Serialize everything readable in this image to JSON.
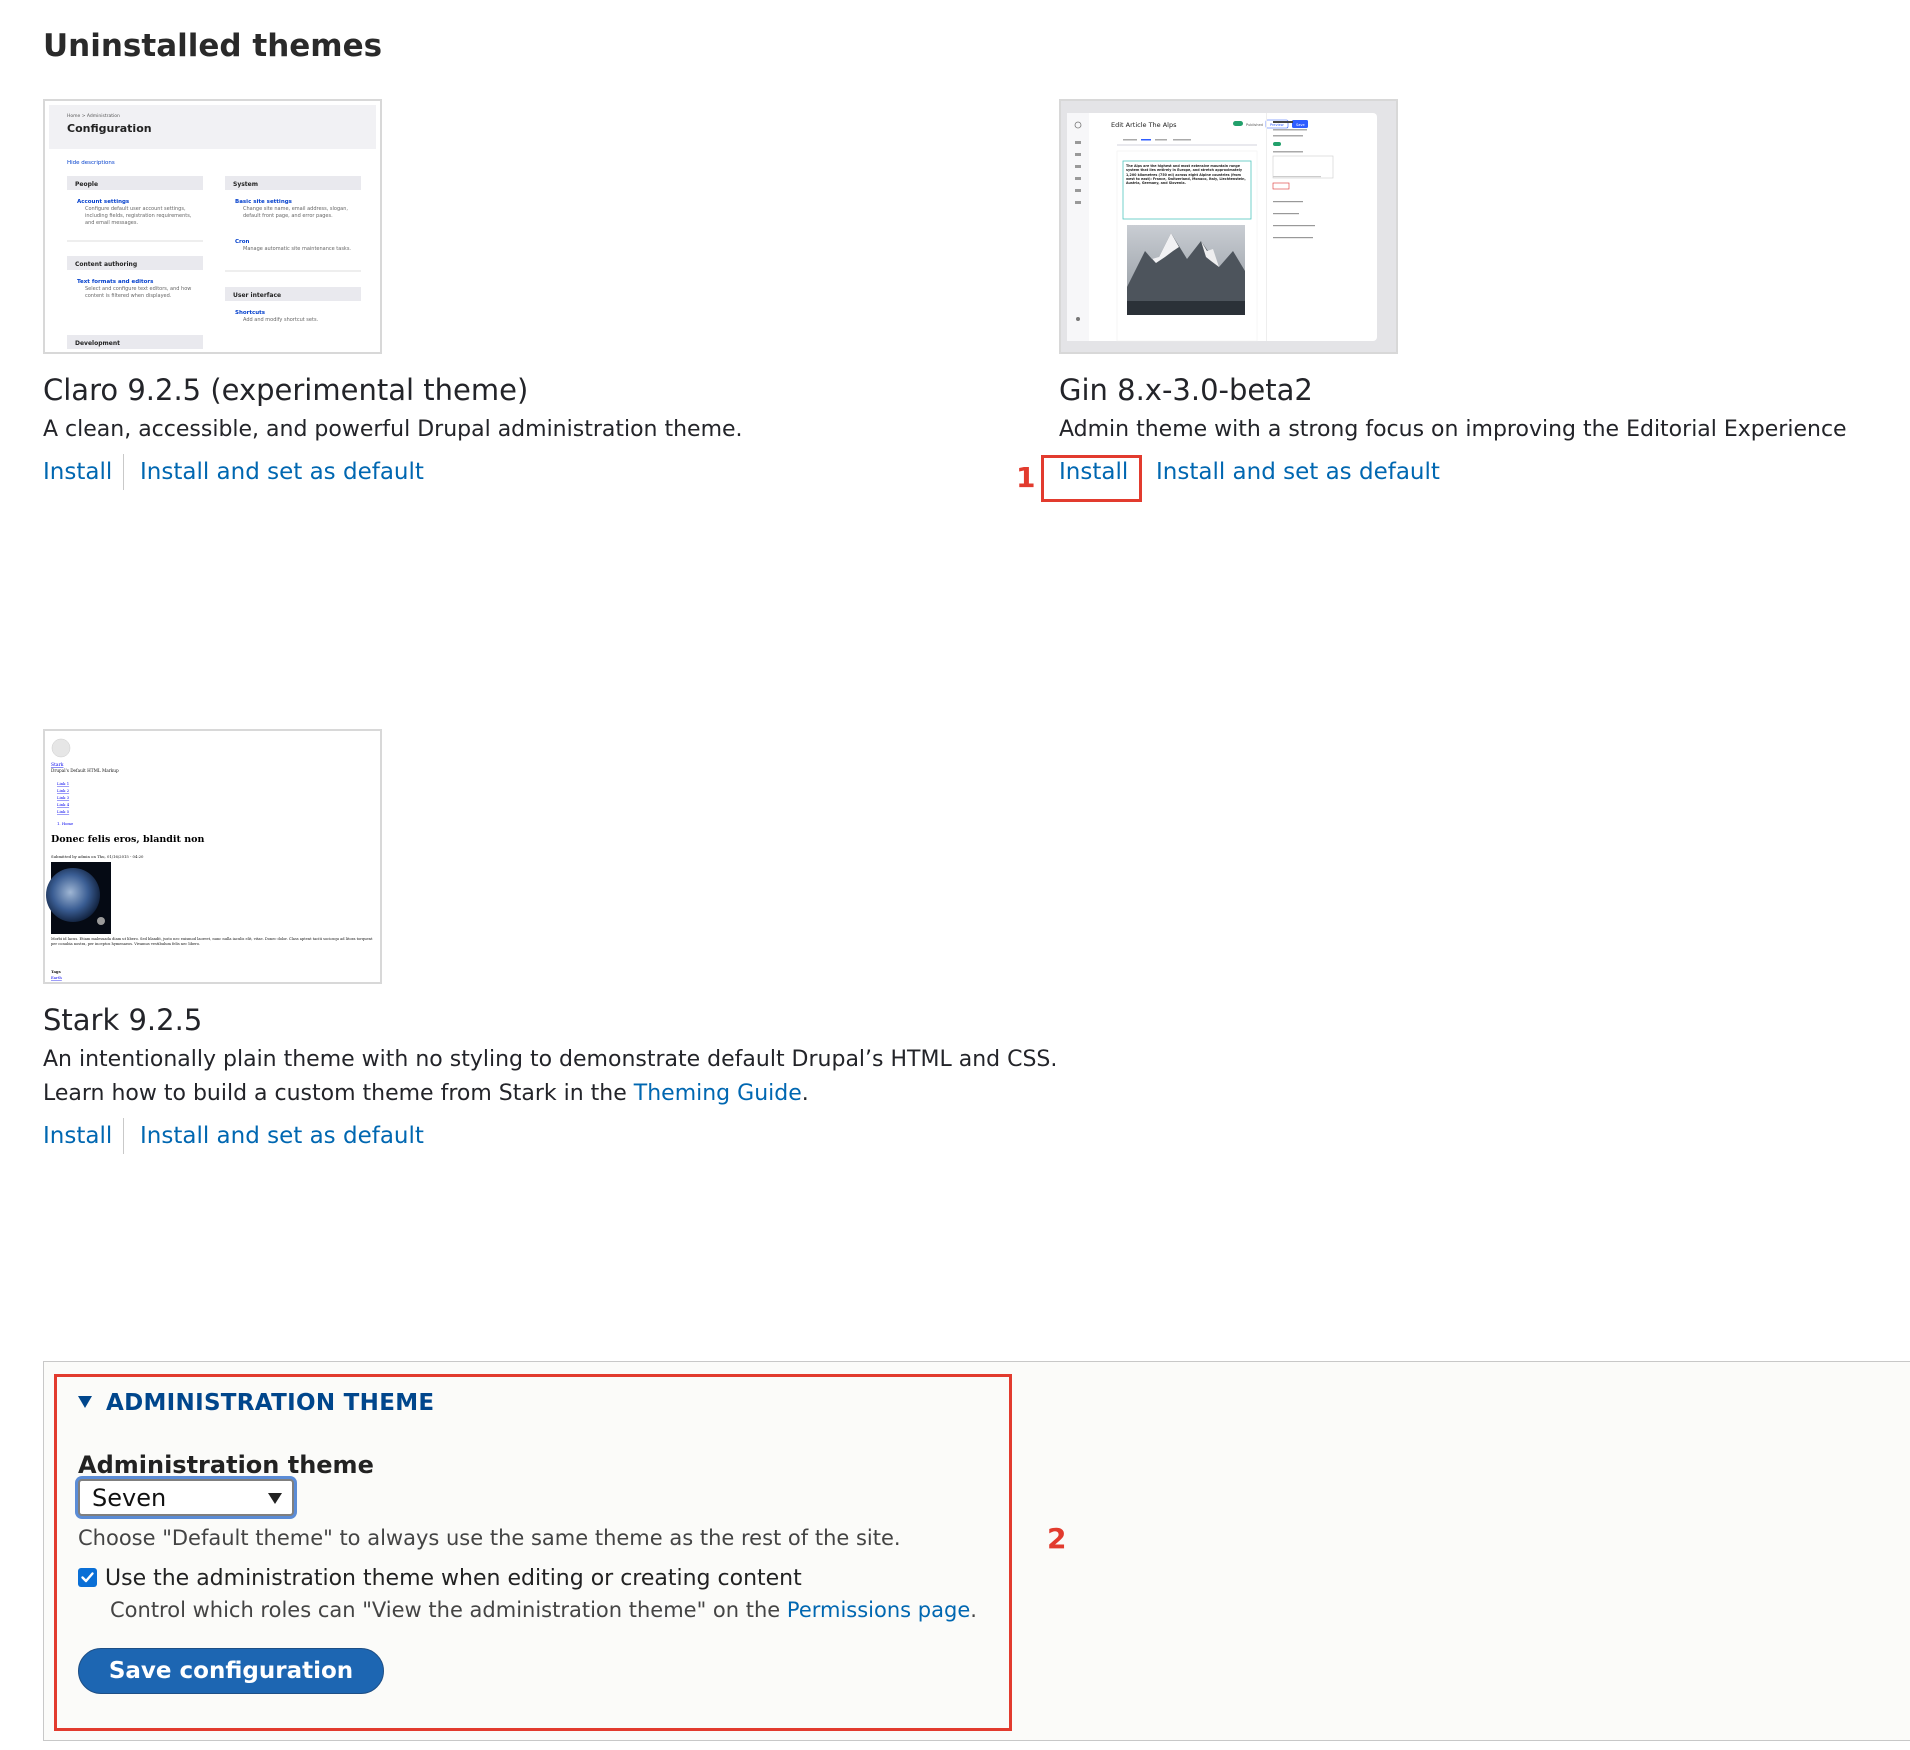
{
  "page": {
    "heading": "Uninstalled themes"
  },
  "themes": [
    {
      "title": "Claro 9.2.5 (experimental theme)",
      "description": "A clean, accessible, and powerful Drupal administration theme.",
      "install_label": "Install",
      "install_default_label": "Install and set as default",
      "screenshot": {
        "breadcrumb": "Home  >  Administration",
        "page_title": "Configuration",
        "hide_link": "Hide descriptions",
        "people": "People",
        "account_settings": "Account settings",
        "account_desc": "Configure default user account settings, including fields, registration requirements, and email messages.",
        "content_authoring": "Content authoring",
        "text_formats": "Text formats and editors",
        "text_formats_desc": "Select and configure text editors, and how content is filtered when displayed.",
        "development": "Development",
        "system": "System",
        "basic_site": "Basic site settings",
        "basic_site_desc": "Change site name, email address, slogan, default front page, and error pages.",
        "cron": "Cron",
        "cron_desc": "Manage automatic site maintenance tasks.",
        "user_interface": "User interface",
        "shortcuts": "Shortcuts",
        "shortcuts_desc": "Add and modify shortcut sets."
      }
    },
    {
      "title": "Gin 8.x-3.0-beta2",
      "description": "Admin theme with a strong focus on improving the Editorial Experience",
      "install_label": "Install",
      "install_default_label": "Install and set as default",
      "screenshot": {
        "edit_title": "Edit Article The Alps",
        "published": "Published",
        "preview": "Preview",
        "save": "Save",
        "body_text": "The Alps are the highest and most extensive mountain range system that lies entirely in Europe, and stretch approximately 1,200 kilometres (750 mi) across eight Alpine countries (from west to east): France, Switzerland, Monaco, Italy, Liechtenstein, Austria, Germany, and Slovenia."
      }
    },
    {
      "title": "Stark 9.2.5",
      "description": "An intentionally plain theme with no styling to demonstrate default Drupal’s HTML and CSS.",
      "description2_prefix": "Learn how to build a custom theme from Stark in the ",
      "description2_link": "Theming Guide",
      "description2_suffix": ".",
      "install_label": "Install",
      "install_default_label": "Install and set as default",
      "screenshot": {
        "site_name": "Stark",
        "slogan": "Drupal's Default HTML Markup",
        "links": [
          "Link 1",
          "Link 2",
          "Link 3",
          "Link 4",
          "Link 5"
        ],
        "breadcrumb": "1. Home",
        "article_title": "Donec felis eros, blandit non",
        "submitted": "Submitted by admin on Thu, 01/16/2015 - 04:20",
        "body": "Morbi id lacus. Etiam malesuada diam ut libero. Sed blandit, justo nec euismod laoreet, nunc nulla iaculis elit, vitae. Donec dolor. Class aptent taciti sociosqu ad litora torquent per conubia nostra, per inceptos hymenaeos. Vivamus vestibulum felis nec libero.",
        "tags": "Tags",
        "tag": "Earth"
      }
    }
  ],
  "annotations": {
    "one": "1",
    "two": "2"
  },
  "admin": {
    "legend": "ADMINISTRATION THEME",
    "field_label": "Administration theme",
    "selected": "Seven",
    "select_description": "Choose \"Default theme\" to always use the same theme as the rest of the site.",
    "checkbox_label": "Use the administration theme when editing or creating content",
    "checkbox_checked": true,
    "checkbox_desc_prefix": "Control which roles can \"View the administration theme\" on the ",
    "checkbox_desc_link": "Permissions page",
    "checkbox_desc_suffix": ".",
    "save_label": "Save configuration"
  },
  "colors": {
    "link": "#0067b1",
    "annotation": "#e23b2e",
    "button": "#1d66b2"
  }
}
